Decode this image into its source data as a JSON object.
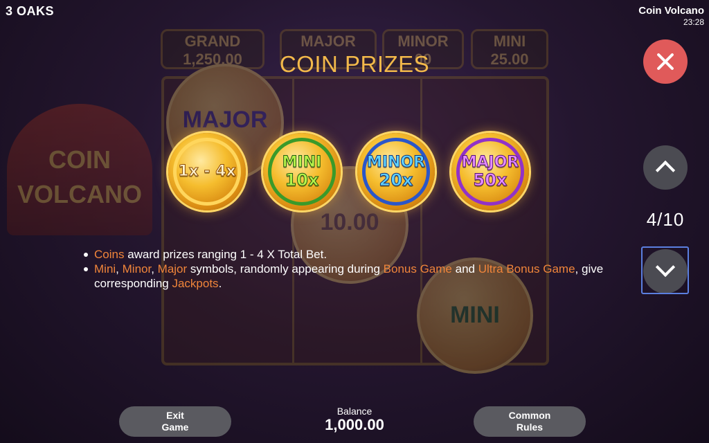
{
  "header": {
    "brand": "3 OAKS",
    "game_name": "Coin Volcano",
    "clock": "23:28"
  },
  "background": {
    "jackpots": [
      {
        "name": "GRAND",
        "value": "1,250.00"
      },
      {
        "name": "MAJOR",
        "value": ""
      },
      {
        "name": "MINOR",
        "value": "00"
      },
      {
        "name": "MINI",
        "value": "25.00"
      }
    ],
    "logo_line1": "COIN",
    "logo_line2": "VOLCANO",
    "reel_symbols": [
      "MAJOR",
      "10.00",
      "MINI"
    ]
  },
  "info_page": {
    "title": "COIN PRIZES",
    "coins": [
      {
        "line1": "1x - 4x",
        "line2": "",
        "style": "gold"
      },
      {
        "line1": "MINI",
        "line2": "10x",
        "style": "green"
      },
      {
        "line1": "MINOR",
        "line2": "20x",
        "style": "blue"
      },
      {
        "line1": "MAJOR",
        "line2": "50x",
        "style": "purple"
      }
    ],
    "bullet1": {
      "hl_coins": "Coins",
      "text": " award prizes ranging 1 - 4 X Total Bet."
    },
    "bullet2": {
      "hl_mini": "Mini",
      "sep1": ", ",
      "hl_minor": "Minor",
      "sep2": ", ",
      "hl_major": "Major",
      "text1": " symbols, randomly appearing during ",
      "hl_bonus": "Bonus Game",
      "text2": " and ",
      "hl_ultra": "Ultra Bonus Game",
      "text3": ", give corresponding ",
      "hl_jackpots": "Jackpots",
      "text4": "."
    }
  },
  "navigation": {
    "page_indicator": "4/10",
    "close_icon": "close-icon",
    "up_icon": "chevron-up-icon",
    "down_icon": "chevron-down-icon"
  },
  "footer": {
    "exit_line1": "Exit",
    "exit_line2": "Game",
    "balance_label": "Balance",
    "balance_value": "1,000.00",
    "rules_line1": "Common",
    "rules_line2": "Rules"
  },
  "colors": {
    "title": "#f2b94a",
    "highlight": "#f0853a",
    "close_button": "#e05a5a",
    "nav_button": "#4b4b52",
    "pill_button": "#5a5a60"
  }
}
